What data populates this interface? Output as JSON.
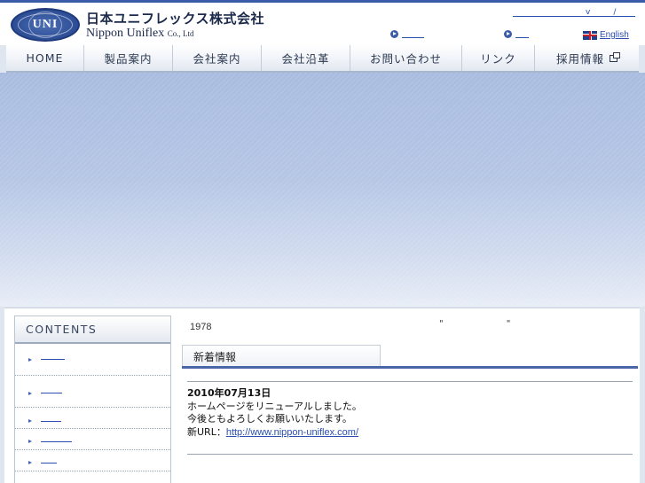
{
  "header": {
    "logo_mark": "UNI",
    "company_jp": "日本ユニフレックス株式会社",
    "company_en": "Nippon Uniflex",
    "company_en_suffix": "Co., Ltd",
    "toplink_marks": [
      "v",
      "/"
    ],
    "english_label": "English",
    "flag_icon": "uk-flag-icon"
  },
  "nav": {
    "items": [
      {
        "label": "HOME"
      },
      {
        "label": "製品案内"
      },
      {
        "label": "会社案内"
      },
      {
        "label": "会社沿革"
      },
      {
        "label": "お問い合わせ"
      },
      {
        "label": "リンク"
      },
      {
        "label": "採用情報"
      }
    ]
  },
  "sidebar": {
    "title": "CONTENTS"
  },
  "main": {
    "intro_year": "1978",
    "quote_marks": "\" \"",
    "news_tab_title": "新着情報",
    "news": {
      "date": "2010年07月13日",
      "line1": "ホームページをリニューアルしました。",
      "line2": "今後ともよろしくお願いいたします。",
      "url_prefix": "新URL：",
      "url": "http://www.nippon-uniflex.com/"
    }
  },
  "colors": {
    "accent": "#3a5ca8",
    "link": "#2a4fb0",
    "hero_top": "#a9bce0"
  }
}
